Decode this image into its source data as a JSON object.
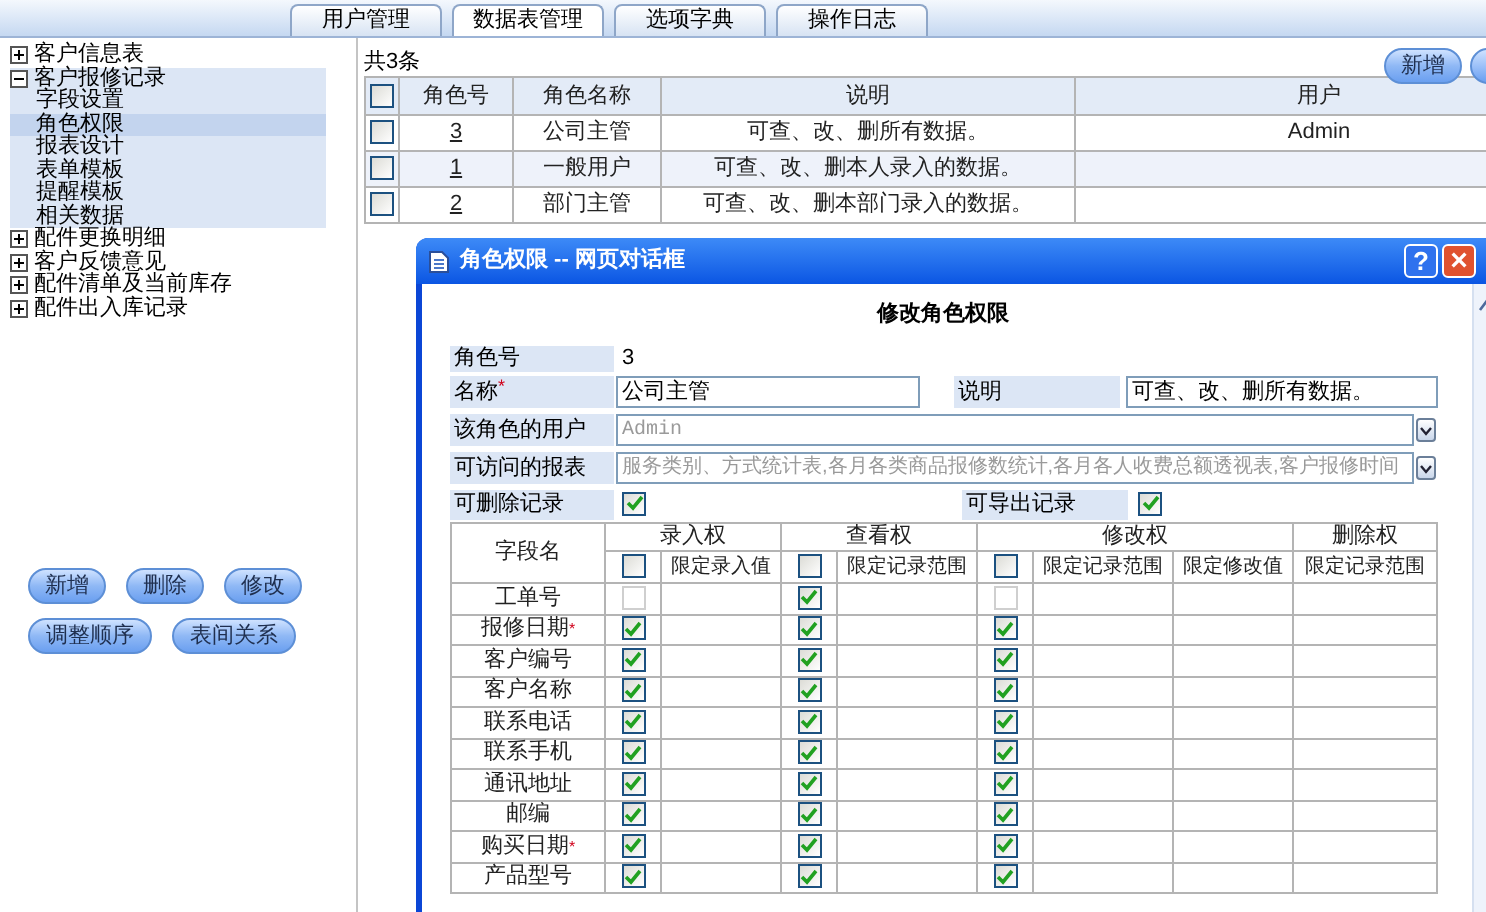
{
  "tabs": [
    {
      "label": "用户管理",
      "selected": false
    },
    {
      "label": "数据表管理",
      "selected": true
    },
    {
      "label": "选项字典",
      "selected": false
    },
    {
      "label": "操作日志",
      "selected": false
    }
  ],
  "tree": [
    {
      "label": "客户信息表",
      "expanded": false
    },
    {
      "label": "客户报修记录",
      "expanded": true,
      "children": [
        {
          "label": "字段设置",
          "selected": false
        },
        {
          "label": "角色权限",
          "selected": true
        },
        {
          "label": "报表设计",
          "selected": false
        },
        {
          "label": "表单模板",
          "selected": false
        },
        {
          "label": "提醒模板",
          "selected": false
        },
        {
          "label": "相关数据",
          "selected": false
        }
      ]
    },
    {
      "label": "配件更换明细",
      "expanded": false
    },
    {
      "label": "客户反馈意见",
      "expanded": false
    },
    {
      "label": "配件清单及当前库存",
      "expanded": false
    },
    {
      "label": "配件出入库记录",
      "expanded": false
    }
  ],
  "left_buttons": [
    [
      "新增",
      "删除",
      "修改"
    ],
    [
      "调整顺序",
      "表间关系"
    ]
  ],
  "record_count": "共3条",
  "toolbar_buttons": [
    "新增"
  ],
  "roles_table": {
    "header_checked": false,
    "columns": [
      "角色号",
      "角色名称",
      "说明",
      "用户"
    ],
    "rows": [
      {
        "checked": false,
        "id": "3",
        "name": "公司主管",
        "description": "可查、改、删所有数据。",
        "user": "Admin"
      },
      {
        "checked": false,
        "id": "1",
        "name": "一般用户",
        "description": "可查、改、删本人录入的数据。"
      },
      {
        "checked": false,
        "id": "2",
        "name": "部门主管",
        "description": "可查、改、删本部门录入的数据。"
      }
    ]
  },
  "dialog": {
    "title": "角色权限 -- 网页对话框",
    "help": "?",
    "close": "×",
    "heading": "修改角色权限",
    "role_number": {
      "label": "角色号",
      "value": "3"
    },
    "name": {
      "label": "名称",
      "required_mark": "*",
      "value": "公司主管"
    },
    "description": {
      "label": "说明",
      "value": "可查、改、删所有数据。"
    },
    "users": {
      "label": "该角色的用户",
      "value": "Admin"
    },
    "reports": {
      "label": "可访问的报表",
      "value": "服务类别、方式统计表,各月各类商品报修数统计,各月各人收费总额透视表,客户报修时间"
    },
    "can_delete": {
      "label": "可删除记录",
      "checked": true
    },
    "can_export": {
      "label": "可导出记录",
      "checked": true
    },
    "permissions": {
      "field_header": "字段名",
      "groups": [
        "录入权",
        "查看权",
        "修改权",
        "删除权"
      ],
      "subheaders": [
        "限定录入值",
        "限定记录范围",
        "限定记录范围",
        "限定修改值",
        "限定记录范围"
      ],
      "entry_all": false,
      "view_all": false,
      "modify_all": false,
      "rows": [
        {
          "field": "工单号",
          "entry": false,
          "entry_disabled": true,
          "view": true,
          "view_disabled": false,
          "modify": false,
          "modify_disabled": true
        },
        {
          "field": "报修日期",
          "required_mark": "*",
          "entry": true,
          "entry_disabled": false,
          "view": true,
          "view_disabled": false,
          "modify": true,
          "modify_disabled": false
        },
        {
          "field": "客户编号",
          "entry": true,
          "entry_disabled": false,
          "view": true,
          "view_disabled": false,
          "modify": true,
          "modify_disabled": false
        },
        {
          "field": "客户名称",
          "entry": true,
          "entry_disabled": false,
          "view": true,
          "view_disabled": false,
          "modify": true,
          "modify_disabled": false
        },
        {
          "field": "联系电话",
          "entry": true,
          "entry_disabled": false,
          "view": true,
          "view_disabled": false,
          "modify": true,
          "modify_disabled": false
        },
        {
          "field": "联系手机",
          "entry": true,
          "entry_disabled": false,
          "view": true,
          "view_disabled": false,
          "modify": true,
          "modify_disabled": false
        },
        {
          "field": "通讯地址",
          "entry": true,
          "entry_disabled": false,
          "view": true,
          "view_disabled": false,
          "modify": true,
          "modify_disabled": false
        },
        {
          "field": "邮编",
          "entry": true,
          "entry_disabled": false,
          "view": true,
          "view_disabled": false,
          "modify": true,
          "modify_disabled": false
        },
        {
          "field": "购买日期",
          "required_mark": "*",
          "entry": true,
          "entry_disabled": false,
          "view": true,
          "view_disabled": false,
          "modify": true,
          "modify_disabled": false
        },
        {
          "field": "产品型号",
          "entry": true,
          "entry_disabled": false,
          "view": true,
          "view_disabled": false,
          "modify": true,
          "modify_disabled": false
        }
      ]
    }
  }
}
